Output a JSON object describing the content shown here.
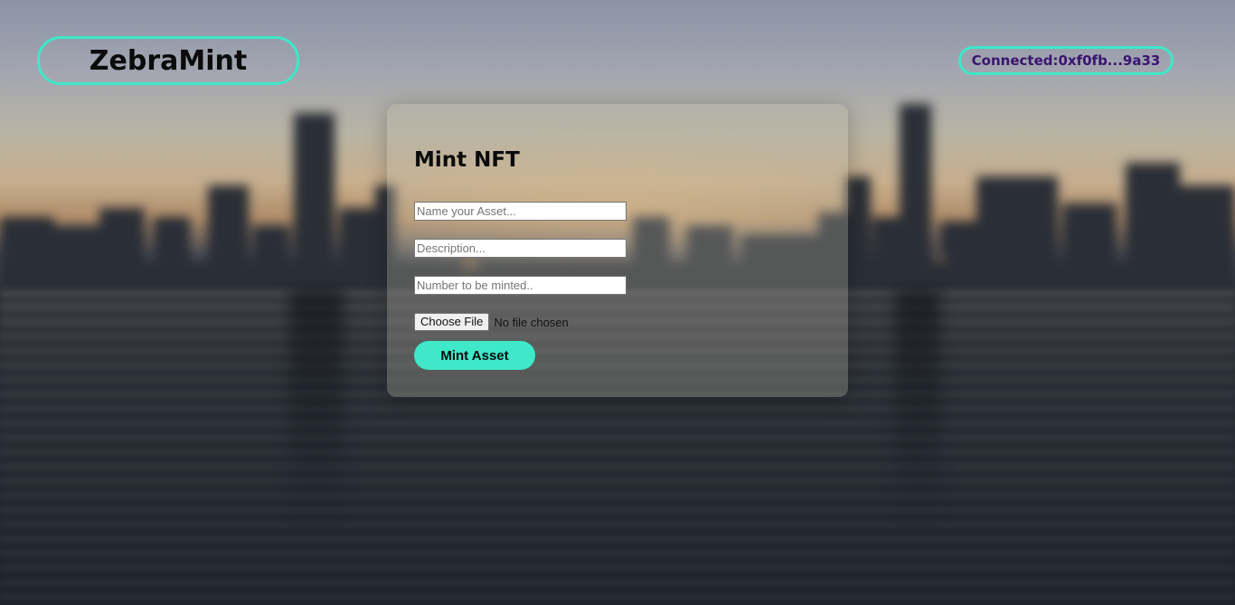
{
  "header": {
    "brand": "ZebraMint",
    "wallet_status": "Connected:0xf0fb...9a33"
  },
  "mint_form": {
    "title": "Mint NFT",
    "name_placeholder": "Name your Asset...",
    "description_placeholder": "Description...",
    "quantity_placeholder": "Number to be minted..",
    "file_button_label": "Choose File",
    "file_status": "No file chosen",
    "submit_label": "Mint Asset"
  },
  "colors": {
    "accent": "#3ee8c9",
    "wallet_text": "#3b1470"
  }
}
